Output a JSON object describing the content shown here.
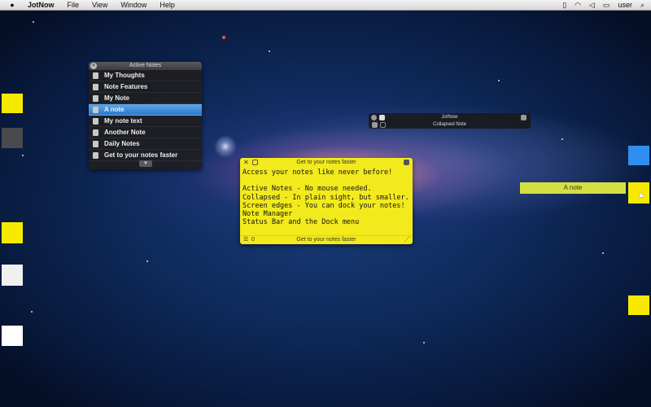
{
  "menubar": {
    "app_name": "JotNow",
    "menus": [
      "File",
      "View",
      "Window",
      "Help"
    ],
    "user": "user"
  },
  "active_notes": {
    "title": "Active Notes",
    "items": [
      {
        "label": "My Thoughts"
      },
      {
        "label": "Note Features"
      },
      {
        "label": "My Note"
      },
      {
        "label": "A note",
        "selected": true
      },
      {
        "label": "My note text"
      },
      {
        "label": "Another Note"
      },
      {
        "label": "Daily Notes"
      },
      {
        "label": "Get to your notes faster"
      }
    ]
  },
  "jotnow_panel": {
    "title": "JotNow",
    "subtitle": "Collapsed Note"
  },
  "note": {
    "title": "Get to your notes faster",
    "body": "Access your notes like never before!\n\nActive Notes - No mouse needed.\nCollapsed - In plain sight, but smaller.\nScreen edges - You can dock your notes!\nNote Manager\nStatus Bar and the Dock menu",
    "footer_count": "0",
    "footer_title": "Get to your notes faster",
    "color": "#f2ea1c"
  },
  "collapsed_bar": {
    "label": "A note",
    "color": "#d4e042"
  },
  "colors": {
    "selection": "#2d77c8",
    "docked_yellow": "#f7ea00",
    "docked_blue": "#2f8ff0"
  }
}
